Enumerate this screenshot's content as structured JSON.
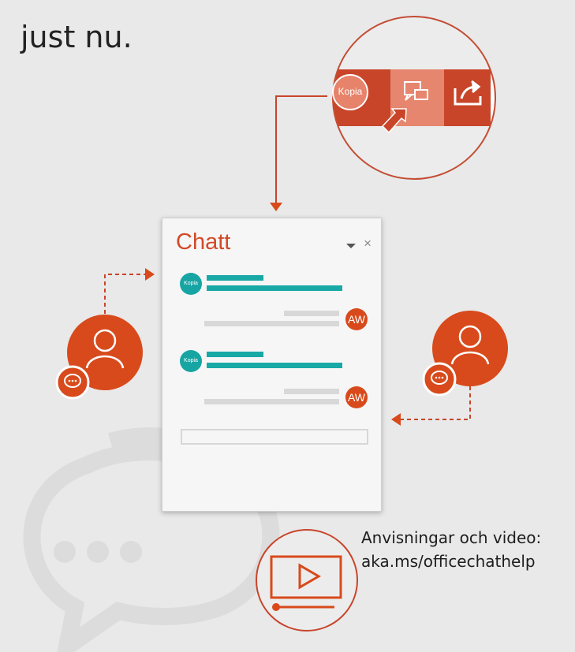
{
  "heading": {
    "text": "just nu."
  },
  "toolbar_callout": {
    "kopia_label": "Kopia",
    "icons": [
      "chat-bubble-icon",
      "share-icon",
      "cursor-arrow-icon"
    ]
  },
  "chat_panel": {
    "title": "Chatt",
    "close_label": "×",
    "messages": [
      {
        "sender_badge": "Kopia",
        "side": "left"
      },
      {
        "sender_badge": "AW",
        "side": "right"
      },
      {
        "sender_badge": "Kopia",
        "side": "left"
      },
      {
        "sender_badge": "AW",
        "side": "right"
      }
    ]
  },
  "help": {
    "line1": "Anvisningar och video:",
    "line2": "aka.ms/officechathelp"
  },
  "colors": {
    "accent_orange": "#d84a1b",
    "teal": "#16a5a3",
    "background": "#e9e9e9",
    "panel": "#f6f6f6"
  }
}
